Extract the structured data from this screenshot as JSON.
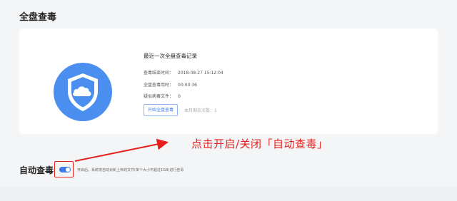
{
  "header": {
    "title": "全盘查毒"
  },
  "scan_card": {
    "title": "最近一次全盘查毒记录",
    "end_time_label": "查毒结束时间：",
    "end_time_value": "2018-08-27 15:12:04",
    "duration_label": "全盘查毒用时：",
    "duration_value": "00:00:36",
    "suspicious_label": "疑似病毒文件：",
    "suspicious_value": "0",
    "scan_button_label": "开始全盘查毒",
    "remaining_label": "本月剩余次数：1"
  },
  "annotation": {
    "text": "点击开启/关闭「自动查毒」",
    "color": "#e5201c"
  },
  "auto_scan": {
    "title": "自动查毒",
    "enabled": true,
    "description": "开启后，系统将自动对新上传的文件(单个大小不超过1GB)进行查毒"
  },
  "colors": {
    "accent": "#3d7ce8",
    "shield": "#4a8ff0",
    "annotation_red": "#e5201c"
  },
  "icons": {
    "shield": "shield-cloud-icon"
  }
}
